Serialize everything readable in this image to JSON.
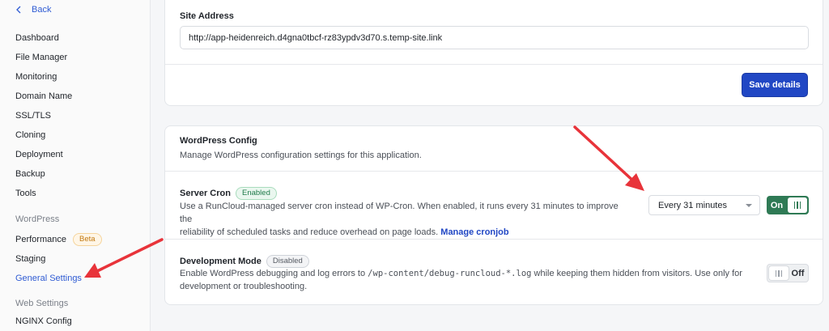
{
  "sidebar": {
    "back_label": "Back",
    "items": [
      {
        "label": "Dashboard"
      },
      {
        "label": "File Manager"
      },
      {
        "label": "Monitoring"
      },
      {
        "label": "Domain Name"
      },
      {
        "label": "SSL/TLS"
      },
      {
        "label": "Cloning"
      },
      {
        "label": "Deployment"
      },
      {
        "label": "Backup"
      },
      {
        "label": "Tools"
      }
    ],
    "wordpress_section": "WordPress",
    "wordpress_items": [
      {
        "label": "Performance",
        "badge": "Beta"
      },
      {
        "label": "Staging"
      },
      {
        "label": "General Settings",
        "active": true
      }
    ],
    "web_section": "Web Settings",
    "web_items": [
      {
        "label": "NGINX Config"
      }
    ]
  },
  "site_address": {
    "label": "Site Address",
    "value": "http://app-heidenreich.d4gna0tbcf-rz83ypdv3d70.s.temp-site.link",
    "save_label": "Save details"
  },
  "wp_config": {
    "title": "WordPress Config",
    "subtitle": "Manage WordPress configuration settings for this application.",
    "server_cron": {
      "title": "Server Cron",
      "badge": "Enabled",
      "desc_line1": "Use a RunCloud-managed server cron instead of WP-Cron. When enabled, it runs every 31 minutes to improve the",
      "desc_line2": "reliability of scheduled tasks and reduce overhead on page loads.",
      "link": "Manage cronjob",
      "interval": "Every 31 minutes",
      "toggle_label": "On"
    },
    "dev_mode": {
      "title": "Development Mode",
      "badge": "Disabled",
      "desc_pre": "Enable WordPress debugging and log errors to ",
      "desc_code": "/wp-content/debug-runcloud-*.log",
      "desc_post": " while keeping them hidden from visitors. Use only for",
      "desc_line2": "development or troubleshooting.",
      "toggle_label": "Off"
    }
  },
  "colors": {
    "accent": "#2147c4",
    "toggle_on": "#2f7a55",
    "annotation_arrow": "#e8333a"
  }
}
